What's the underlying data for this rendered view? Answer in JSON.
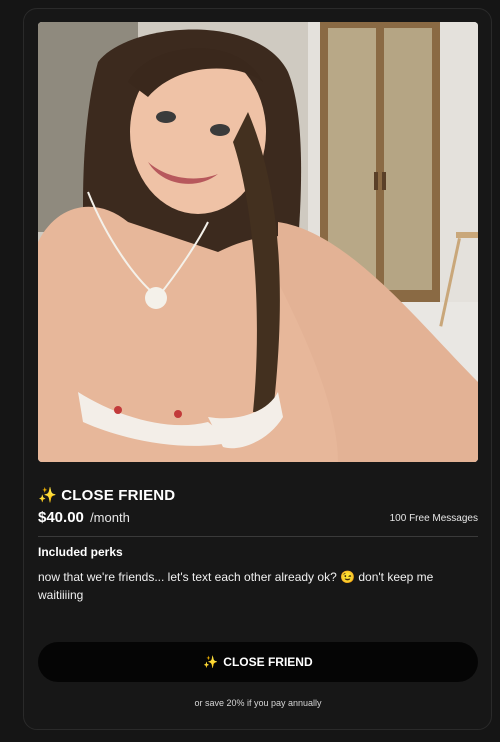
{
  "card": {
    "sparkle_icon": "sparkles-icon",
    "title": "CLOSE FRIEND",
    "price": "$40.00",
    "period": "/month",
    "messages": "100 Free Messages",
    "perks_heading": "Included perks",
    "perks_text": "now that we're friends... let's text each other already ok? 😉 don't keep me waitiiiing",
    "cta_label": "CLOSE FRIEND",
    "footnote": "or save 20% if you pay annually"
  },
  "colors": {
    "background": "#151515",
    "card": "#171717",
    "button": "#050505",
    "text": "#ffffff"
  }
}
